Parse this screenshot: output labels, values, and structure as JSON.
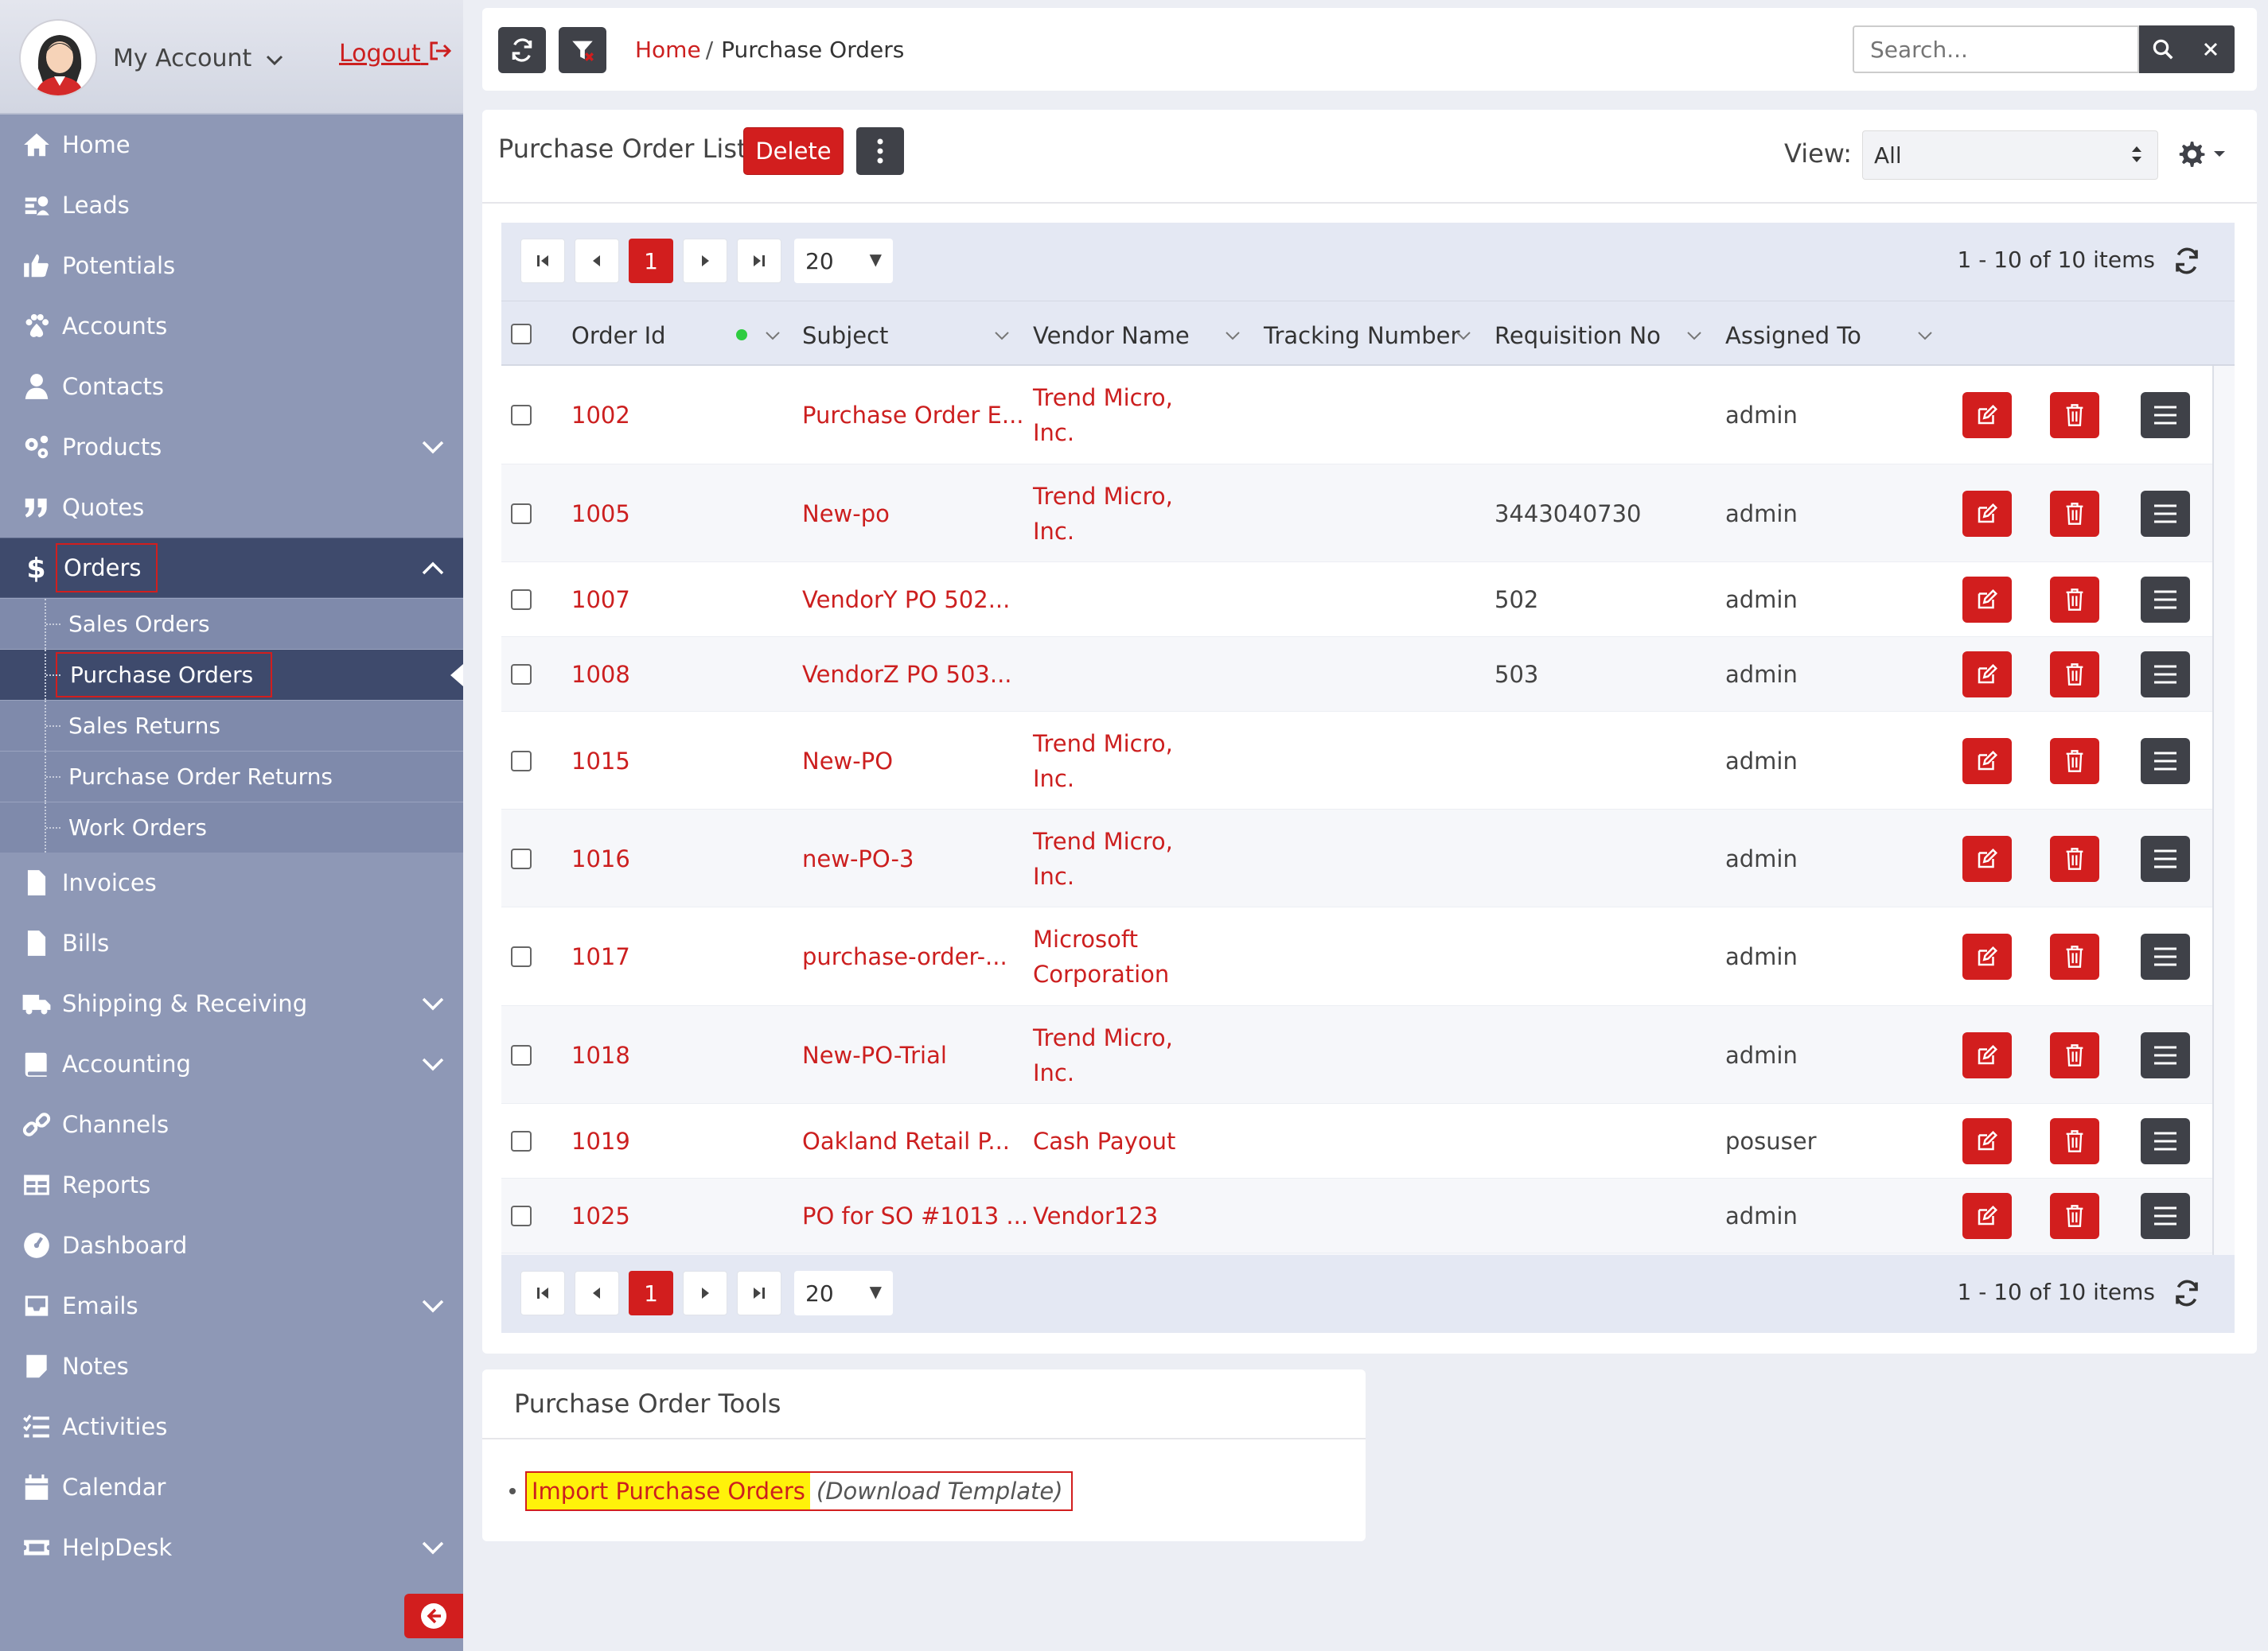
{
  "account": {
    "name": "My Account",
    "logout": "Logout"
  },
  "sidebar": {
    "items": [
      {
        "label": "Home",
        "icon": "home-icon"
      },
      {
        "label": "Leads",
        "icon": "leads-icon"
      },
      {
        "label": "Potentials",
        "icon": "thumbs-up-icon"
      },
      {
        "label": "Accounts",
        "icon": "paw-icon"
      },
      {
        "label": "Contacts",
        "icon": "user-icon"
      },
      {
        "label": "Products",
        "icon": "gears-icon",
        "expandable": true
      },
      {
        "label": "Quotes",
        "icon": "quote-icon"
      },
      {
        "label": "Orders",
        "icon": "dollar-icon",
        "expanded": true
      },
      {
        "label": "Invoices",
        "icon": "file-icon"
      },
      {
        "label": "Bills",
        "icon": "file-text-icon"
      },
      {
        "label": "Shipping & Receiving",
        "icon": "truck-icon",
        "expandable": true
      },
      {
        "label": "Accounting",
        "icon": "book-icon",
        "expandable": true
      },
      {
        "label": "Channels",
        "icon": "link-icon"
      },
      {
        "label": "Reports",
        "icon": "table-icon"
      },
      {
        "label": "Dashboard",
        "icon": "gauge-icon"
      },
      {
        "label": "Emails",
        "icon": "inbox-icon",
        "expandable": true
      },
      {
        "label": "Notes",
        "icon": "note-icon"
      },
      {
        "label": "Activities",
        "icon": "list-check-icon"
      },
      {
        "label": "Calendar",
        "icon": "calendar-icon"
      },
      {
        "label": "HelpDesk",
        "icon": "ticket-icon",
        "expandable": true
      }
    ],
    "orders_sub": [
      "Sales Orders",
      "Purchase Orders",
      "Sales Returns",
      "Purchase Order Returns",
      "Work Orders"
    ]
  },
  "topbar": {
    "breadcrumb_home": "Home",
    "breadcrumb_sep": "/",
    "breadcrumb_current": "Purchase Orders",
    "search_placeholder": "Search..."
  },
  "list": {
    "title": "Purchase Order List",
    "delete_label": "Delete",
    "view_label": "View:",
    "view_value": "All",
    "page": "1",
    "page_size": "20",
    "page_info": "1 - 10 of 10 items",
    "columns": [
      "Order Id",
      "Subject",
      "Vendor Name",
      "Tracking Number",
      "Requisition No",
      "Assigned To"
    ],
    "rows": [
      {
        "id": "1002",
        "subject": "Purchase Order E...",
        "vendor": [
          "Trend Micro,",
          "Inc."
        ],
        "tracking": "",
        "req": "",
        "assigned": "admin"
      },
      {
        "id": "1005",
        "subject": "New-po",
        "vendor": [
          "Trend Micro,",
          "Inc."
        ],
        "tracking": "",
        "req": "3443040730",
        "assigned": "admin"
      },
      {
        "id": "1007",
        "subject": "VendorY PO 502...",
        "vendor": [],
        "tracking": "",
        "req": "502",
        "assigned": "admin"
      },
      {
        "id": "1008",
        "subject": "VendorZ PO 503...",
        "vendor": [],
        "tracking": "",
        "req": "503",
        "assigned": "admin"
      },
      {
        "id": "1015",
        "subject": "New-PO",
        "vendor": [
          "Trend Micro,",
          "Inc."
        ],
        "tracking": "",
        "req": "",
        "assigned": "admin"
      },
      {
        "id": "1016",
        "subject": "new-PO-3",
        "vendor": [
          "Trend Micro,",
          "Inc."
        ],
        "tracking": "",
        "req": "",
        "assigned": "admin"
      },
      {
        "id": "1017",
        "subject": "purchase-order-...",
        "vendor": [
          "Microsoft",
          "Corporation"
        ],
        "tracking": "",
        "req": "",
        "assigned": "admin"
      },
      {
        "id": "1018",
        "subject": "New-PO-Trial",
        "vendor": [
          "Trend Micro,",
          "Inc."
        ],
        "tracking": "",
        "req": "",
        "assigned": "admin"
      },
      {
        "id": "1019",
        "subject": "Oakland Retail P...",
        "vendor": [
          "Cash Payout"
        ],
        "tracking": "",
        "req": "",
        "assigned": "posuser"
      },
      {
        "id": "1025",
        "subject": "PO for SO #1013 ...",
        "vendor": [
          "Vendor123"
        ],
        "tracking": "",
        "req": "",
        "assigned": "admin"
      }
    ]
  },
  "tools": {
    "title": "Purchase Order Tools",
    "import_label": "Import Purchase Orders",
    "download_label": "(Download Template)"
  },
  "colors": {
    "accent": "#d21e1e",
    "sidebar": "#8e98b6",
    "sidebar_active": "#3e4a6c",
    "dark_button": "#3f4148"
  }
}
